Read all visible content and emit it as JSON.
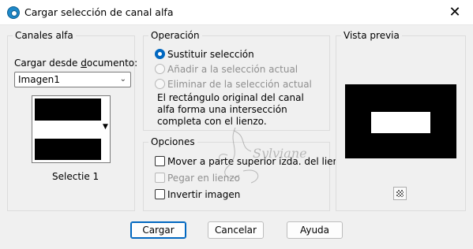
{
  "window": {
    "title": "Cargar selección de canal alfa",
    "close_glyph": "✕"
  },
  "canales": {
    "legend": "Canales alfa",
    "load_label": "Cargar desde documento:",
    "document_value": "Imagen1",
    "channel_name": "Selectie 1"
  },
  "operacion": {
    "legend": "Operación",
    "options": [
      {
        "label": "Sustituir selección",
        "checked": true,
        "enabled": true
      },
      {
        "label": "Añadir a la selección actual",
        "checked": false,
        "enabled": false
      },
      {
        "label": "Eliminar de la selección actual",
        "checked": false,
        "enabled": false
      }
    ],
    "description": "El rectángulo original del canal alfa forma una intersección completa con el lienzo."
  },
  "opciones": {
    "legend": "Opciones",
    "items": [
      {
        "label": "Mover a parte superior izda. del lienzo",
        "checked": false,
        "enabled": true
      },
      {
        "label": "Pegar en lienzo",
        "checked": false,
        "enabled": false
      },
      {
        "label": "Invertir imagen",
        "checked": false,
        "enabled": true
      }
    ]
  },
  "preview": {
    "legend": "Vista previa"
  },
  "buttons": {
    "load": "Cargar",
    "cancel": "Cancelar",
    "help": "Ayuda"
  },
  "watermark": {
    "text": "Sylviane"
  },
  "colors": {
    "accent": "#0067c0",
    "dialog_bg": "#f0f0f0",
    "disabled_text": "#8f8f8f"
  }
}
